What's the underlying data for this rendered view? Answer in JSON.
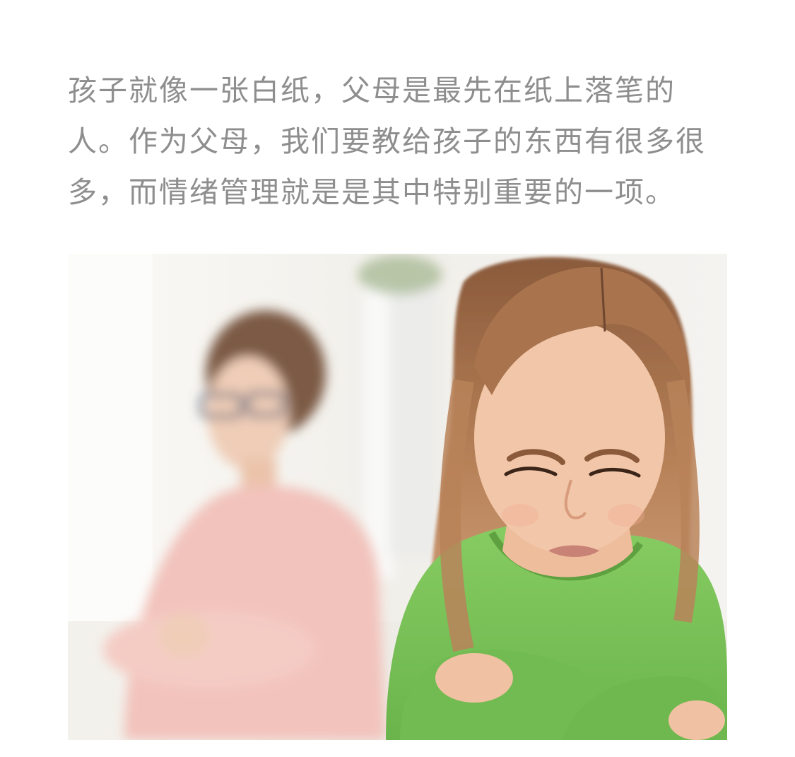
{
  "article": {
    "paragraph_lines": [
      "孩子就像一张白纸，父母是最先在纸上落笔的",
      "人。作为父母，我们要教给孩子的东西有很多很",
      "多，而情绪管理就是是其中特别重要的一项。"
    ],
    "photo": {
      "colors": {
        "background": "#f4f2ee",
        "mother_shirt": "#f2c3bc",
        "girl_shirt": "#7bc35a",
        "girl_hair": "#b07a54",
        "skin": "#f2c6a8"
      }
    }
  }
}
